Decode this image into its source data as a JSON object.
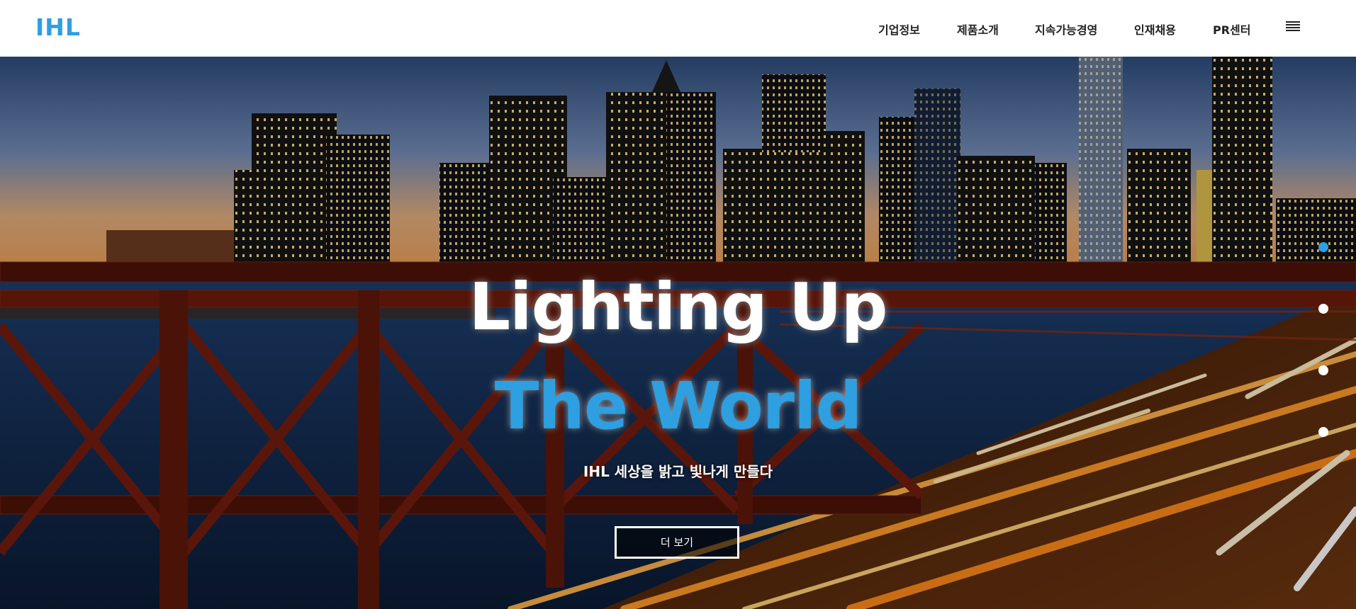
{
  "header": {
    "logo": "IHL",
    "nav": [
      {
        "label": "기업정보"
      },
      {
        "label": "제품소개"
      },
      {
        "label": "지속가능경영"
      },
      {
        "label": "인재채용"
      },
      {
        "label": "PR센터"
      }
    ],
    "menu_icon": "hamburger-menu-icon"
  },
  "hero": {
    "title_line1": "Lighting Up",
    "title_line2": "The World",
    "subtitle": "IHL 세상을 밝고 빛나게 만들다",
    "button_label": "더 보기",
    "slide_count": 4,
    "active_slide": 1
  },
  "colors": {
    "brand": "#2e9fe0",
    "nav_text": "#222222",
    "header_bg": "#ffffff"
  }
}
